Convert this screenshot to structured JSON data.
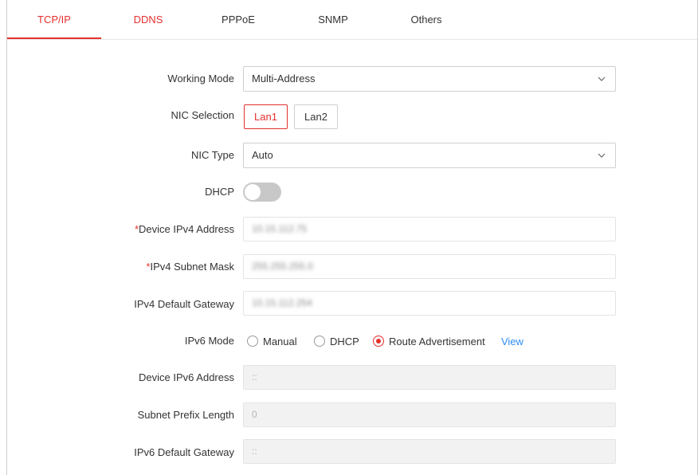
{
  "tabs": [
    {
      "label": "TCP/IP",
      "active": true
    },
    {
      "label": "DDNS",
      "active": false
    },
    {
      "label": "PPPoE",
      "active": false
    },
    {
      "label": "SNMP",
      "active": false
    },
    {
      "label": "Others",
      "active": false
    }
  ],
  "colors": {
    "accent": "#e5302e",
    "link": "#2d8cf0"
  },
  "form": {
    "working_mode": {
      "label": "Working Mode",
      "value": "Multi-Address"
    },
    "nic_selection": {
      "label": "NIC Selection",
      "options": [
        "Lan1",
        "Lan2"
      ],
      "selected": "Lan1"
    },
    "nic_type": {
      "label": "NIC Type",
      "value": "Auto"
    },
    "dhcp": {
      "label": "DHCP",
      "enabled": false
    },
    "device_ipv4": {
      "required_mark": "*",
      "label": "Device IPv4 Address",
      "value": "10.15.112.75"
    },
    "ipv4_subnet": {
      "required_mark": "*",
      "label": "IPv4 Subnet Mask",
      "value": "255.255.255.0"
    },
    "ipv4_gateway": {
      "label": "IPv4 Default Gateway",
      "value": "10.15.112.254"
    },
    "ipv6_mode": {
      "label": "IPv6 Mode",
      "options": [
        "Manual",
        "DHCP",
        "Route Advertisement"
      ],
      "selected": "Route Advertisement",
      "view_link": "View"
    },
    "device_ipv6": {
      "label": "Device IPv6 Address",
      "value": "::"
    },
    "prefix_length": {
      "label": "Subnet Prefix Length",
      "value": "0"
    },
    "ipv6_gateway": {
      "label": "IPv6 Default Gateway",
      "value": "::"
    }
  },
  "icons": {
    "dropdown": "chevron-down-icon"
  }
}
